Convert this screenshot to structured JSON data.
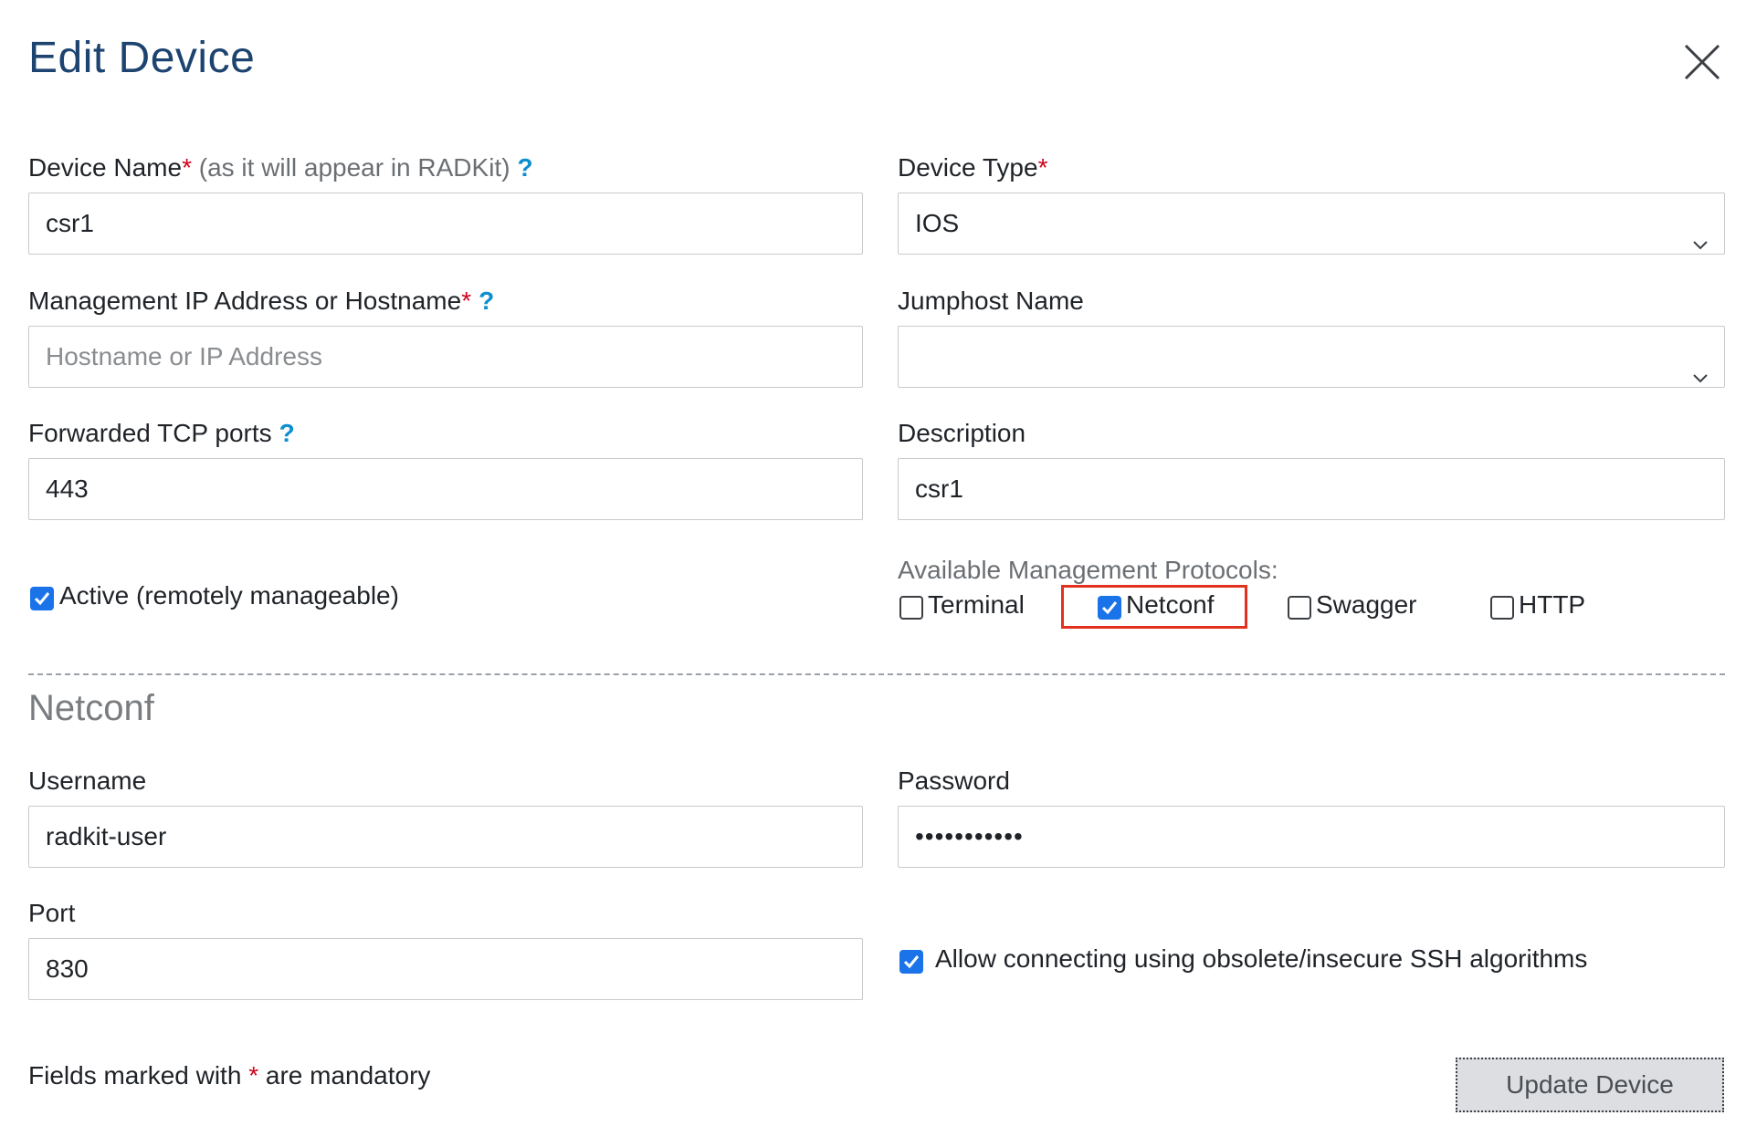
{
  "dialog": {
    "title": "Edit Device"
  },
  "form": {
    "device_name": {
      "label": "Device Name",
      "required_mark": "*",
      "hint": "(as it will appear in RADKit)",
      "help": "?",
      "value": "csr1"
    },
    "device_type": {
      "label": "Device Type",
      "required_mark": "*",
      "value": "IOS"
    },
    "management_ip": {
      "label": "Management IP Address or Hostname",
      "required_mark": "*",
      "help": "?",
      "value": "",
      "placeholder": "Hostname or IP Address"
    },
    "jumphost_name": {
      "label": "Jumphost Name",
      "value": ""
    },
    "forwarded_ports": {
      "label": "Forwarded TCP ports",
      "help": "?",
      "value": "443"
    },
    "description": {
      "label": "Description",
      "value": "csr1"
    },
    "active": {
      "label": "Active (remotely manageable)",
      "checked": true
    },
    "protocols": {
      "label": "Available Management Protocols:",
      "items": [
        {
          "label": "Terminal",
          "checked": false
        },
        {
          "label": "Netconf",
          "checked": true,
          "highlighted": true
        },
        {
          "label": "Swagger",
          "checked": false
        },
        {
          "label": "HTTP",
          "checked": false
        }
      ]
    }
  },
  "netconf": {
    "section_title": "Netconf",
    "username": {
      "label": "Username",
      "value": "radkit-user"
    },
    "password": {
      "label": "Password",
      "value": "•••••••••••"
    },
    "port": {
      "label": "Port",
      "value": "830"
    },
    "obsolete_ssh": {
      "label": "Allow connecting using obsolete/insecure SSH algorithms",
      "checked": true
    }
  },
  "footer": {
    "note_prefix": "Fields marked with",
    "note_mark": "*",
    "note_suffix": "are mandatory",
    "update_button": "Update Device"
  },
  "colors": {
    "title": "#1d4470",
    "required": "#d0021b",
    "help": "#0d8fcf",
    "checkbox_on": "#1a73e8",
    "highlight": "#e0321f"
  }
}
